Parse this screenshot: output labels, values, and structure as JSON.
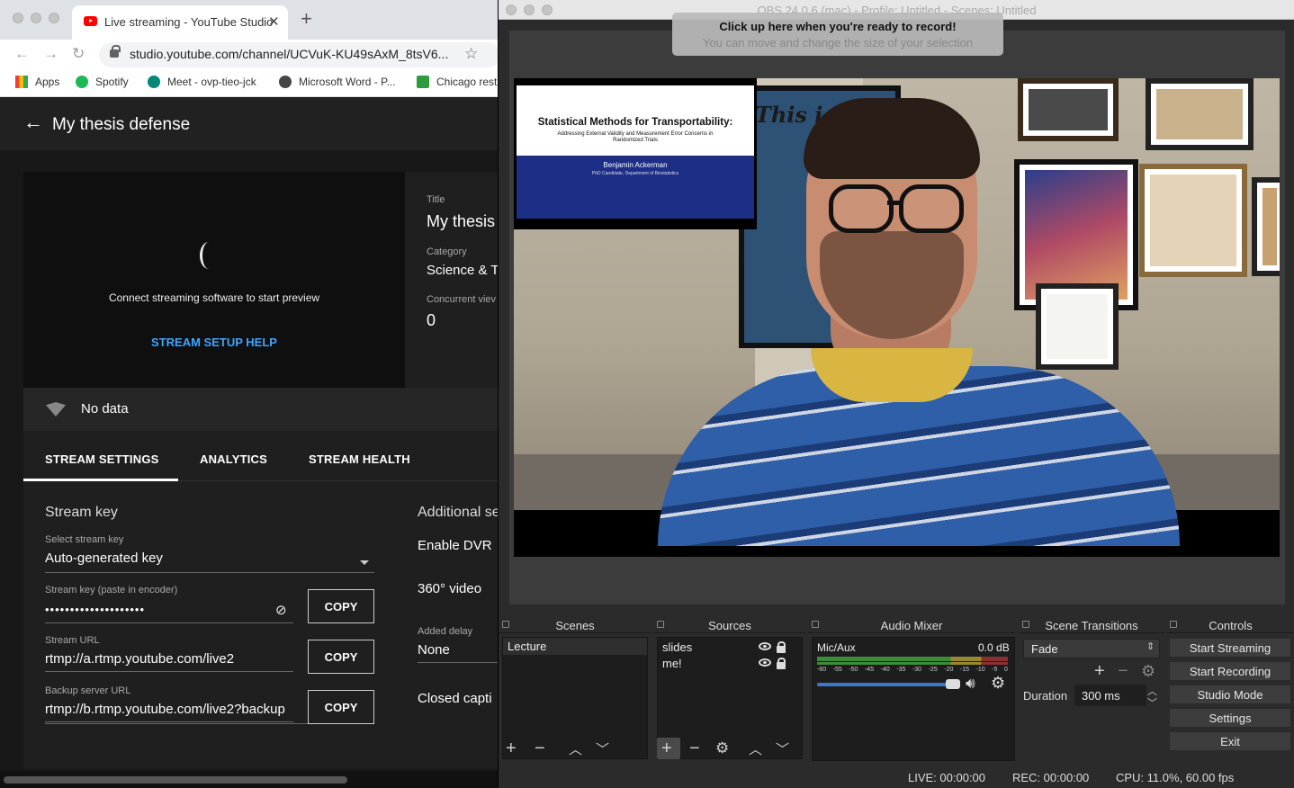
{
  "browser": {
    "tab_title": "Live streaming - YouTube Studio",
    "url": "studio.youtube.com/channel/UCVuK-KU49sAxM_8tsV6...",
    "bookmarks": [
      "Apps",
      "Spotify",
      "Meet - ovp-tieo-jck",
      "Microsoft Word - P...",
      "Chicago rest"
    ]
  },
  "studio": {
    "page_title": "My thesis defense",
    "preview_message": "Connect streaming software to start preview",
    "setup_help": "STREAM SETUP HELP",
    "info": {
      "title_label": "Title",
      "title_value": "My thesis",
      "category_label": "Category",
      "category_value": "Science & T",
      "viewers_label": "Concurrent viev",
      "viewers_value": "0"
    },
    "no_data": "No data",
    "tabs": [
      "STREAM SETTINGS",
      "ANALYTICS",
      "STREAM HEALTH"
    ],
    "stream_key": {
      "heading": "Stream key",
      "select_label": "Select stream key",
      "select_value": "Auto-generated key",
      "key_label": "Stream key (paste in encoder)",
      "key_value": "••••••••••••••••••••",
      "url_label": "Stream URL",
      "url_value": "rtmp://a.rtmp.youtube.com/live2",
      "backup_label": "Backup server URL",
      "backup_value": "rtmp://b.rtmp.youtube.com/live2?backup",
      "copy": "COPY"
    },
    "additional": {
      "heading": "Additional se",
      "dvr": "Enable DVR",
      "video360": "360° video",
      "delay_label": "Added delay",
      "delay_value": "None",
      "captions": "Closed capti"
    }
  },
  "obs": {
    "window_title": "OBS 24.0.6 (mac) - Profile: Untitled - Scenes: Untitled",
    "hint_title": "Click up here when you're ready to record!",
    "hint_sub": "You can move and change the size of your selection",
    "slide": {
      "title": "Statistical Methods for Transportability:",
      "subtitle": "Addressing External Validity and Measurement Error Concerns in",
      "subtitle2": "Randomized Trials",
      "author": "Benjamin Ackerman",
      "affiliation": "PhD Candidate, Department of Biostatistics"
    },
    "poster_text": "This i",
    "docks": {
      "scenes": {
        "title": "Scenes",
        "items": [
          "Lecture"
        ]
      },
      "sources": {
        "title": "Sources",
        "items": [
          "slides",
          "me!"
        ]
      },
      "mixer": {
        "title": "Audio Mixer",
        "channel": "Mic/Aux",
        "level": "0.0 dB",
        "scale": [
          "-60",
          "-55",
          "-50",
          "-45",
          "-40",
          "-35",
          "-30",
          "-25",
          "-20",
          "-15",
          "-10",
          "-5",
          "0"
        ]
      },
      "transitions": {
        "title": "Scene Transitions",
        "type": "Fade",
        "duration_label": "Duration",
        "duration_value": "300 ms"
      },
      "controls": {
        "title": "Controls",
        "buttons": [
          "Start Streaming",
          "Start Recording",
          "Studio Mode",
          "Settings",
          "Exit"
        ]
      }
    },
    "status": {
      "live": "LIVE: 00:00:00",
      "rec": "REC: 00:00:00",
      "cpu": "CPU: 11.0%, 60.00 fps"
    }
  }
}
